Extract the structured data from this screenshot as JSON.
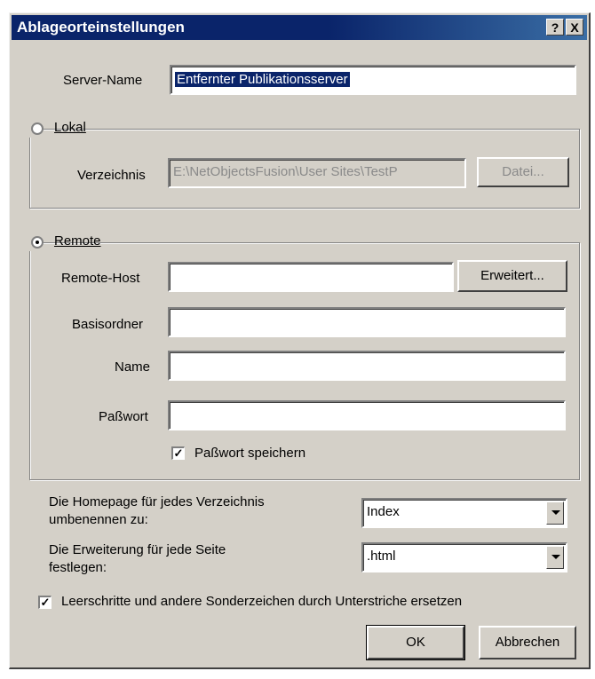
{
  "window": {
    "title": "Ablageorteinstellungen",
    "help_button": "?",
    "close_button": "X"
  },
  "server_name": {
    "label": "Server-Name",
    "value": "Entfernter Publikationsserver"
  },
  "lokal": {
    "option_label": "Lokal",
    "selected": false,
    "verzeichnis_label": "Verzeichnis",
    "verzeichnis_value": "E:\\NetObjectsFusion\\User Sites\\TestP",
    "datei_button": "Datei..."
  },
  "remote": {
    "option_label": "Remote",
    "selected": true,
    "remote_host_label": "Remote-Host",
    "remote_host_value": "",
    "erweitert_button": "Erweitert...",
    "basisordner_label": "Basisordner",
    "basisordner_value": "",
    "name_label": "Name",
    "name_value": "",
    "passwort_label": "Paßwort",
    "passwort_value": "",
    "save_password_label": "Paßwort speichern",
    "save_password_checked": true
  },
  "homepage": {
    "label_line1": "Die Homepage für jedes Verzeichnis",
    "label_line2": "umbenennen zu:",
    "selected": "Index"
  },
  "extension": {
    "label_line1": "Die Erweiterung für jede Seite",
    "label_line2": "festlegen:",
    "selected": ".html"
  },
  "replace_spaces": {
    "label": "Leerschritte und andere Sonderzeichen durch Unterstriche ersetzen",
    "checked": true
  },
  "buttons": {
    "ok": "OK",
    "cancel": "Abbrechen"
  }
}
